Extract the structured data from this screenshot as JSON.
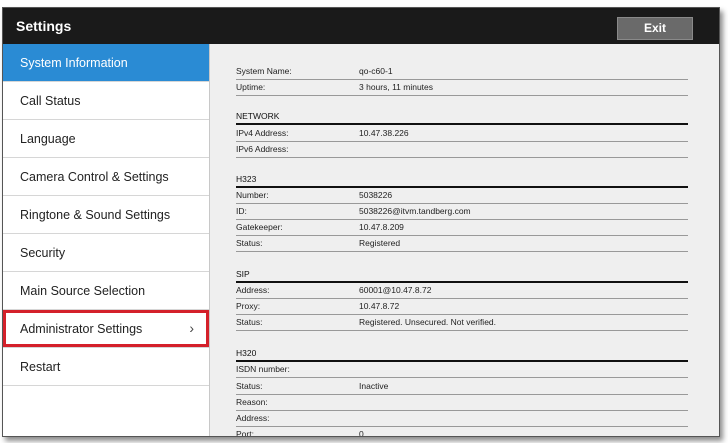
{
  "header": {
    "title": "Settings",
    "exit_label": "Exit"
  },
  "sidebar": {
    "items": [
      {
        "label": "System Information"
      },
      {
        "label": "Call Status"
      },
      {
        "label": "Language"
      },
      {
        "label": "Camera Control & Settings"
      },
      {
        "label": "Ringtone & Sound Settings"
      },
      {
        "label": "Security"
      },
      {
        "label": "Main Source Selection"
      },
      {
        "label": "Administrator Settings"
      },
      {
        "label": "Restart"
      }
    ]
  },
  "info": {
    "system_name_label": "System Name:",
    "system_name": "qo-c60-1",
    "uptime_label": "Uptime:",
    "uptime": "3 hours, 11 minutes",
    "network": {
      "heading": "NETWORK",
      "ipv4_label": "IPv4 Address:",
      "ipv4": "10.47.38.226",
      "ipv6_label": "IPv6 Address:",
      "ipv6": ""
    },
    "h323": {
      "heading": "H323",
      "number_label": "Number:",
      "number": "5038226",
      "id_label": "ID:",
      "id": "5038226@itvm.tandberg.com",
      "gatekeeper_label": "Gatekeeper:",
      "gatekeeper": "10.47.8.209",
      "status_label": "Status:",
      "status": "Registered"
    },
    "sip": {
      "heading": "SIP",
      "address_label": "Address:",
      "address": "60001@10.47.8.72",
      "proxy_label": "Proxy:",
      "proxy": "10.47.8.72",
      "status_label": "Status:",
      "status": "Registered. Unsecured. Not verified."
    },
    "h320": {
      "heading": "H320",
      "isdn_label": "ISDN number:",
      "isdn": "",
      "status_label": "Status:",
      "status": "Inactive",
      "reason_label": "Reason:",
      "reason": "",
      "address_label": "Address:",
      "address": "",
      "port_label": "Port:",
      "port": "0"
    }
  }
}
